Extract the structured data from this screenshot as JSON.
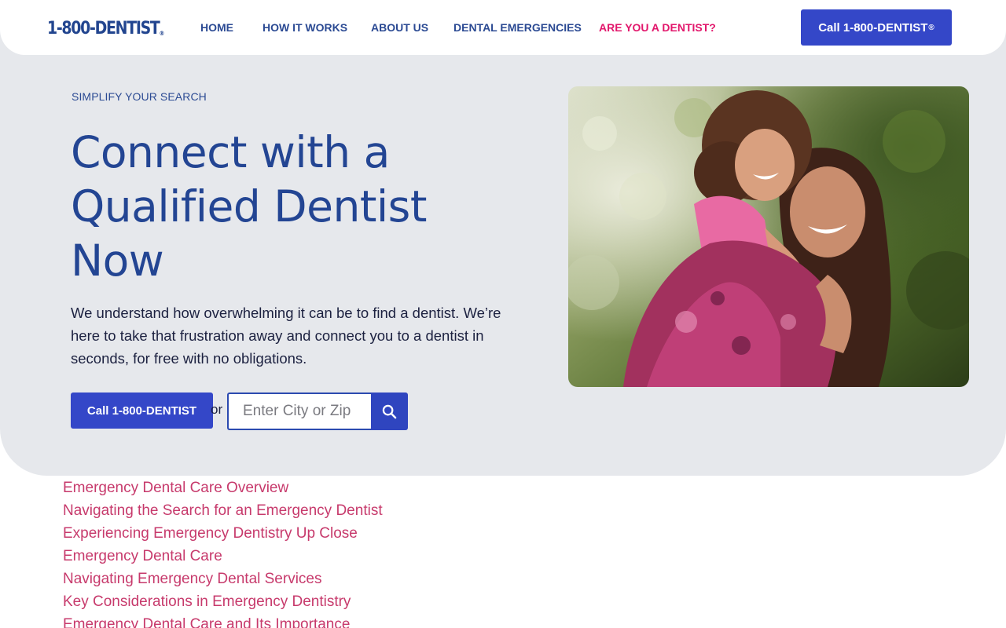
{
  "header": {
    "logo_text": "1-800-DENTIST",
    "logo_mark": "®",
    "nav": [
      {
        "label": "HOME"
      },
      {
        "label": "HOW IT WORKS"
      },
      {
        "label": "ABOUT US"
      },
      {
        "label": "DENTAL EMERGENCIES"
      },
      {
        "label": "ARE YOU A DENTIST?"
      }
    ],
    "cta_label": "Call 1-800-DENTIST",
    "cta_mark": "®"
  },
  "hero": {
    "eyebrow": "SIMPLIFY YOUR SEARCH",
    "headline_line1": "Connect with a",
    "headline_line2": "Qualified Dentist",
    "headline_line3": "Now",
    "subtext": "We understand how overwhelming it can be to find a dentist. We’re here to take that frustration away and connect you to a dentist in seconds, for free with no obligations.",
    "call_button": "Call 1-800-DENTIST",
    "or_text": "or",
    "search_placeholder": "Enter City or Zip",
    "search_icon": "search-icon",
    "photo_alt": "mother-carrying-daughter-piggyback-photo"
  },
  "toc": {
    "links": [
      "Emergency Dental Care Overview",
      "Navigating the Search for an Emergency Dentist",
      "Experiencing Emergency Dentistry Up Close",
      "Emergency Dental Care",
      "Navigating Emergency Dental Services",
      "Key Considerations in Emergency Dentistry",
      "Emergency Dental Care and Its Importance"
    ]
  },
  "colors": {
    "brand_blue": "#3447c8",
    "navy_text": "#234593",
    "accent_pink": "#e2166b",
    "link_pink": "#c73a6c",
    "hero_bg": "#e6e8ec"
  }
}
